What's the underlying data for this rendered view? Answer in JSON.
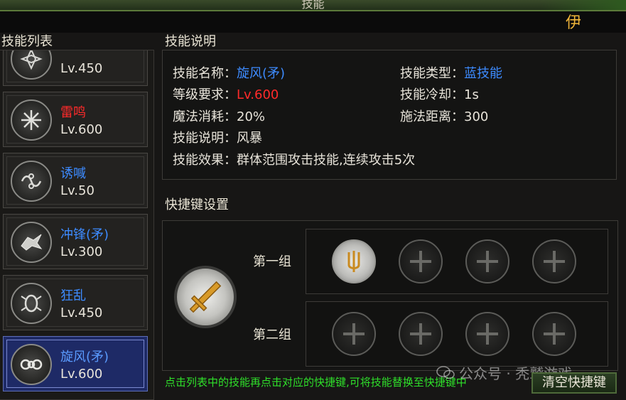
{
  "window": {
    "title": "技能",
    "player_name_partial": "伊"
  },
  "skill_list": {
    "heading": "技能列表",
    "items": [
      {
        "name": "",
        "level": "Lv.450",
        "name_color": "#e8e4da",
        "icon": "lotus-icon",
        "selected": false
      },
      {
        "name": "雷鸣",
        "level": "Lv.600",
        "name_color": "#ff2a2a",
        "icon": "snowflake-icon",
        "selected": false
      },
      {
        "name": "诱喊",
        "level": "Lv.50",
        "name_color": "#3d8bff",
        "icon": "swirl-icon",
        "selected": false
      },
      {
        "name": "冲锋(矛)",
        "level": "Lv.300",
        "name_color": "#3d8bff",
        "icon": "dragon-icon",
        "selected": false
      },
      {
        "name": "狂乱",
        "level": "Lv.450",
        "name_color": "#3d8bff",
        "icon": "beetle-icon",
        "selected": false
      },
      {
        "name": "旋风(矛)",
        "level": "Lv.600",
        "name_color": "#3d8bff",
        "icon": "whirlwind-icon",
        "selected": true
      }
    ]
  },
  "description": {
    "heading": "技能说明",
    "name_label": "技能名称：",
    "name_value": "旋风(矛)",
    "type_label": "技能类型：",
    "type_value": "蓝技能",
    "req_label": "等级要求：",
    "req_value": "Lv.600",
    "cd_label": "技能冷却：",
    "cd_value": "1s",
    "mana_label": "魔法消耗：",
    "mana_value": "20%",
    "range_label": "施法距离：",
    "range_value": "300",
    "desc_label": "技能说明：",
    "desc_value": "风暴",
    "effect_label": "技能效果：",
    "effect_value": "群体范围攻击技能,连续攻击5次"
  },
  "shortcuts": {
    "heading": "快捷键设置",
    "group1_label": "第一组",
    "group2_label": "第二组",
    "hint": "点击列表中的技能再点击对应的快捷键,可将技能替换至快捷键中",
    "clear_button": "清空快捷键"
  },
  "watermark": "公众号 · 秃鹫游戏",
  "colors": {
    "accent_blue": "#3d8bff",
    "level_red": "#ff2a2a",
    "hint_green": "#2fe02a",
    "name_gold": "#f0b53a"
  }
}
